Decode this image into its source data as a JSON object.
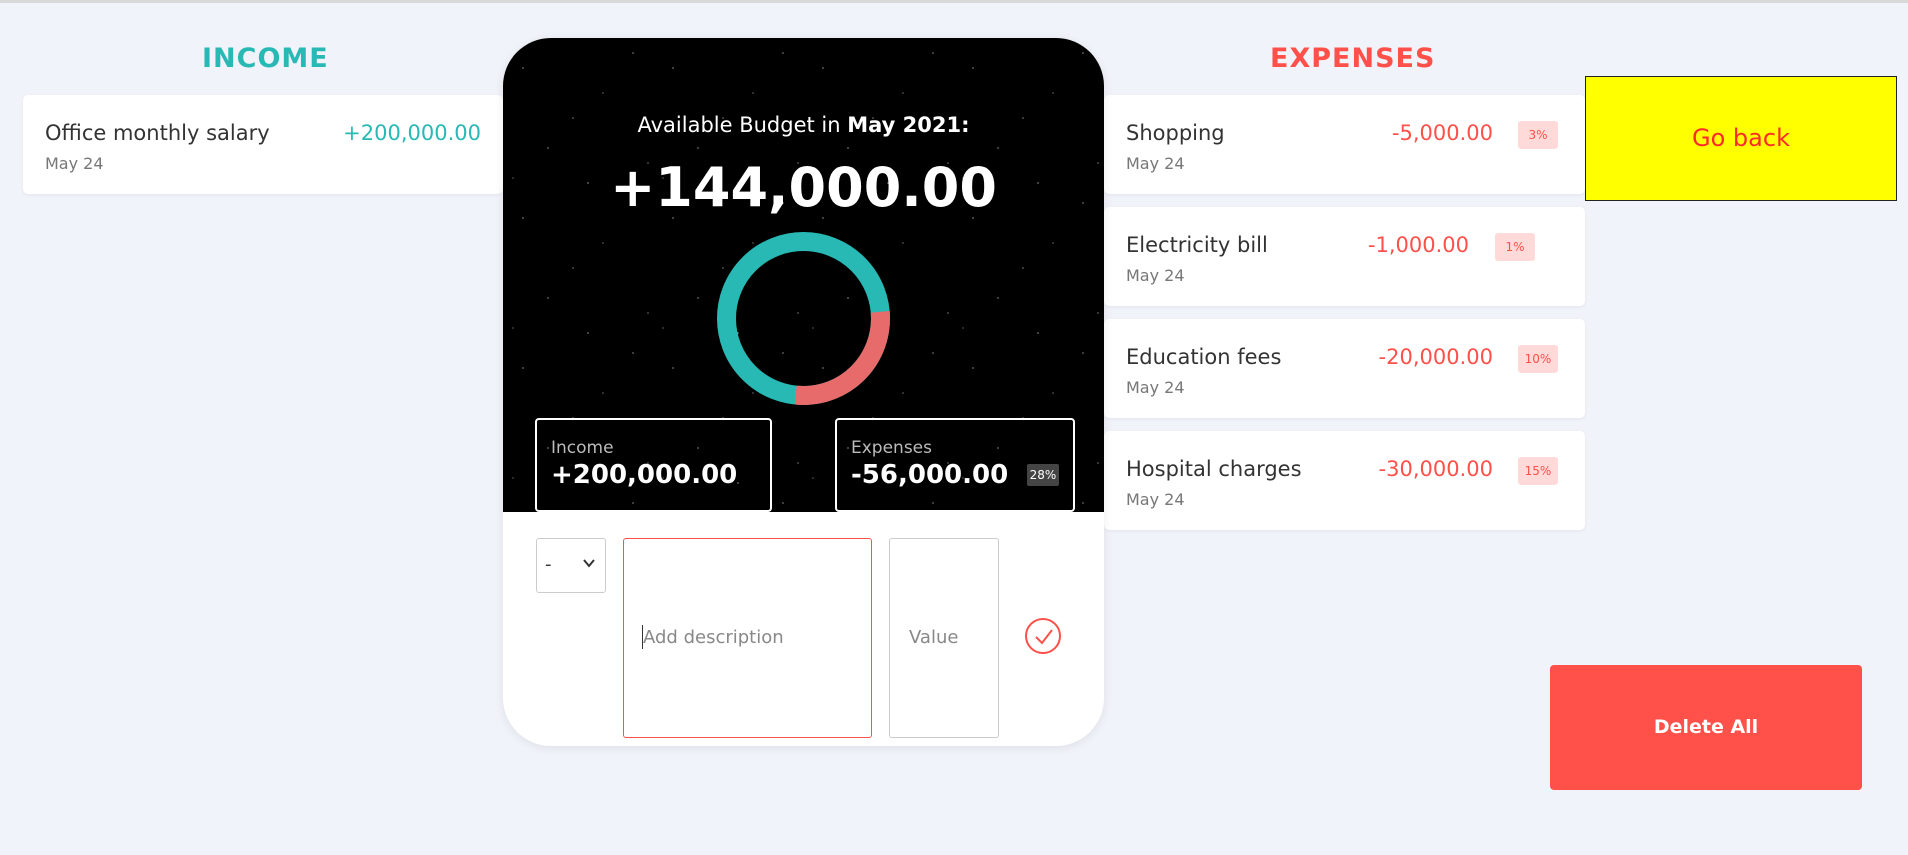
{
  "income": {
    "title": "INCOME",
    "items": [
      {
        "description": "Office monthly salary",
        "date": "May 24",
        "value": "+200,000.00"
      }
    ]
  },
  "expenses": {
    "title": "EXPENSES",
    "items": [
      {
        "description": "Shopping",
        "date": "May 24",
        "value": "-5,000.00",
        "percentage": "3%"
      },
      {
        "description": "Electricity bill",
        "date": "May 24",
        "value": "-1,000.00",
        "percentage": "1%"
      },
      {
        "description": "Education fees",
        "date": "May 24",
        "value": "-20,000.00",
        "percentage": "10%"
      },
      {
        "description": "Hospital charges",
        "date": "May 24",
        "value": "-30,000.00",
        "percentage": "15%"
      }
    ]
  },
  "budget": {
    "label_prefix": "Available Budget in ",
    "month": "May 2021",
    "label_suffix": ":",
    "value": "+144,000.00",
    "chart": {
      "income_value": 200000,
      "expenses_value": 56000,
      "expenses_share": 0.28
    },
    "summary": {
      "income_label": "Income",
      "income_value": "+200,000.00",
      "expenses_label": "Expenses",
      "expenses_value": "-56,000.00",
      "expenses_percentage": "28%"
    }
  },
  "form": {
    "type_selected": "-",
    "description_placeholder": "Add description",
    "value_placeholder": "Value"
  },
  "buttons": {
    "go_back": "Go back",
    "delete_all": "Delete All"
  },
  "colors": {
    "income": "#28b9b5",
    "expense": "#ff5049",
    "go_back_bg": "#ffff00",
    "delete_bg": "#ff5049"
  },
  "icons": {
    "add": "checkmark-circle-icon",
    "select": "chevron-down-icon"
  }
}
